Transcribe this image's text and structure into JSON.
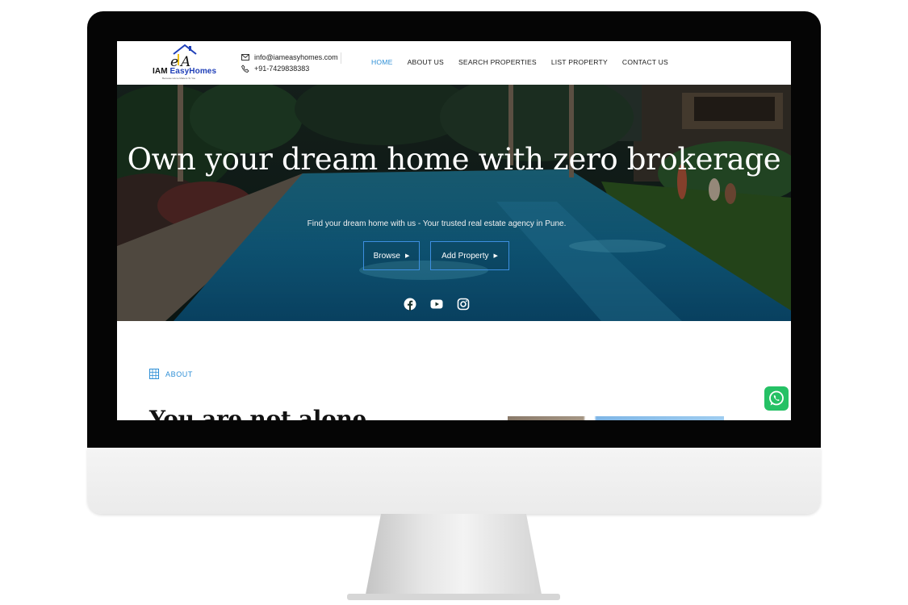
{
  "brand": {
    "name_prefix": "IAM",
    "name_main": "EasyHomes",
    "tagline": "Because Home Matters To You",
    "mark": "eA"
  },
  "contact": {
    "email": "info@iameasyhomes.com",
    "phone": "+91-7429838383"
  },
  "nav": {
    "items": [
      {
        "label": "HOME",
        "active": true
      },
      {
        "label": "ABOUT US",
        "active": false
      },
      {
        "label": "SEARCH PROPERTIES",
        "active": false
      },
      {
        "label": "LIST PROPERTY",
        "active": false
      },
      {
        "label": "CONTACT US",
        "active": false
      }
    ]
  },
  "hero": {
    "title": "Own your dream home with zero brokerage",
    "subtitle": "Find your dream home with us - Your trusted real estate agency in Pune.",
    "buttons": {
      "browse": "Browse",
      "add_property": "Add Property"
    },
    "socials": [
      "facebook-icon",
      "youtube-icon",
      "instagram-icon"
    ]
  },
  "about": {
    "eyebrow": "ABOUT",
    "heading": "You are not alone"
  },
  "colors": {
    "accent": "#2e8fd6",
    "button_border": "#3d8fe0",
    "whatsapp": "#25c165",
    "logo_blue": "#1f3fb8"
  }
}
